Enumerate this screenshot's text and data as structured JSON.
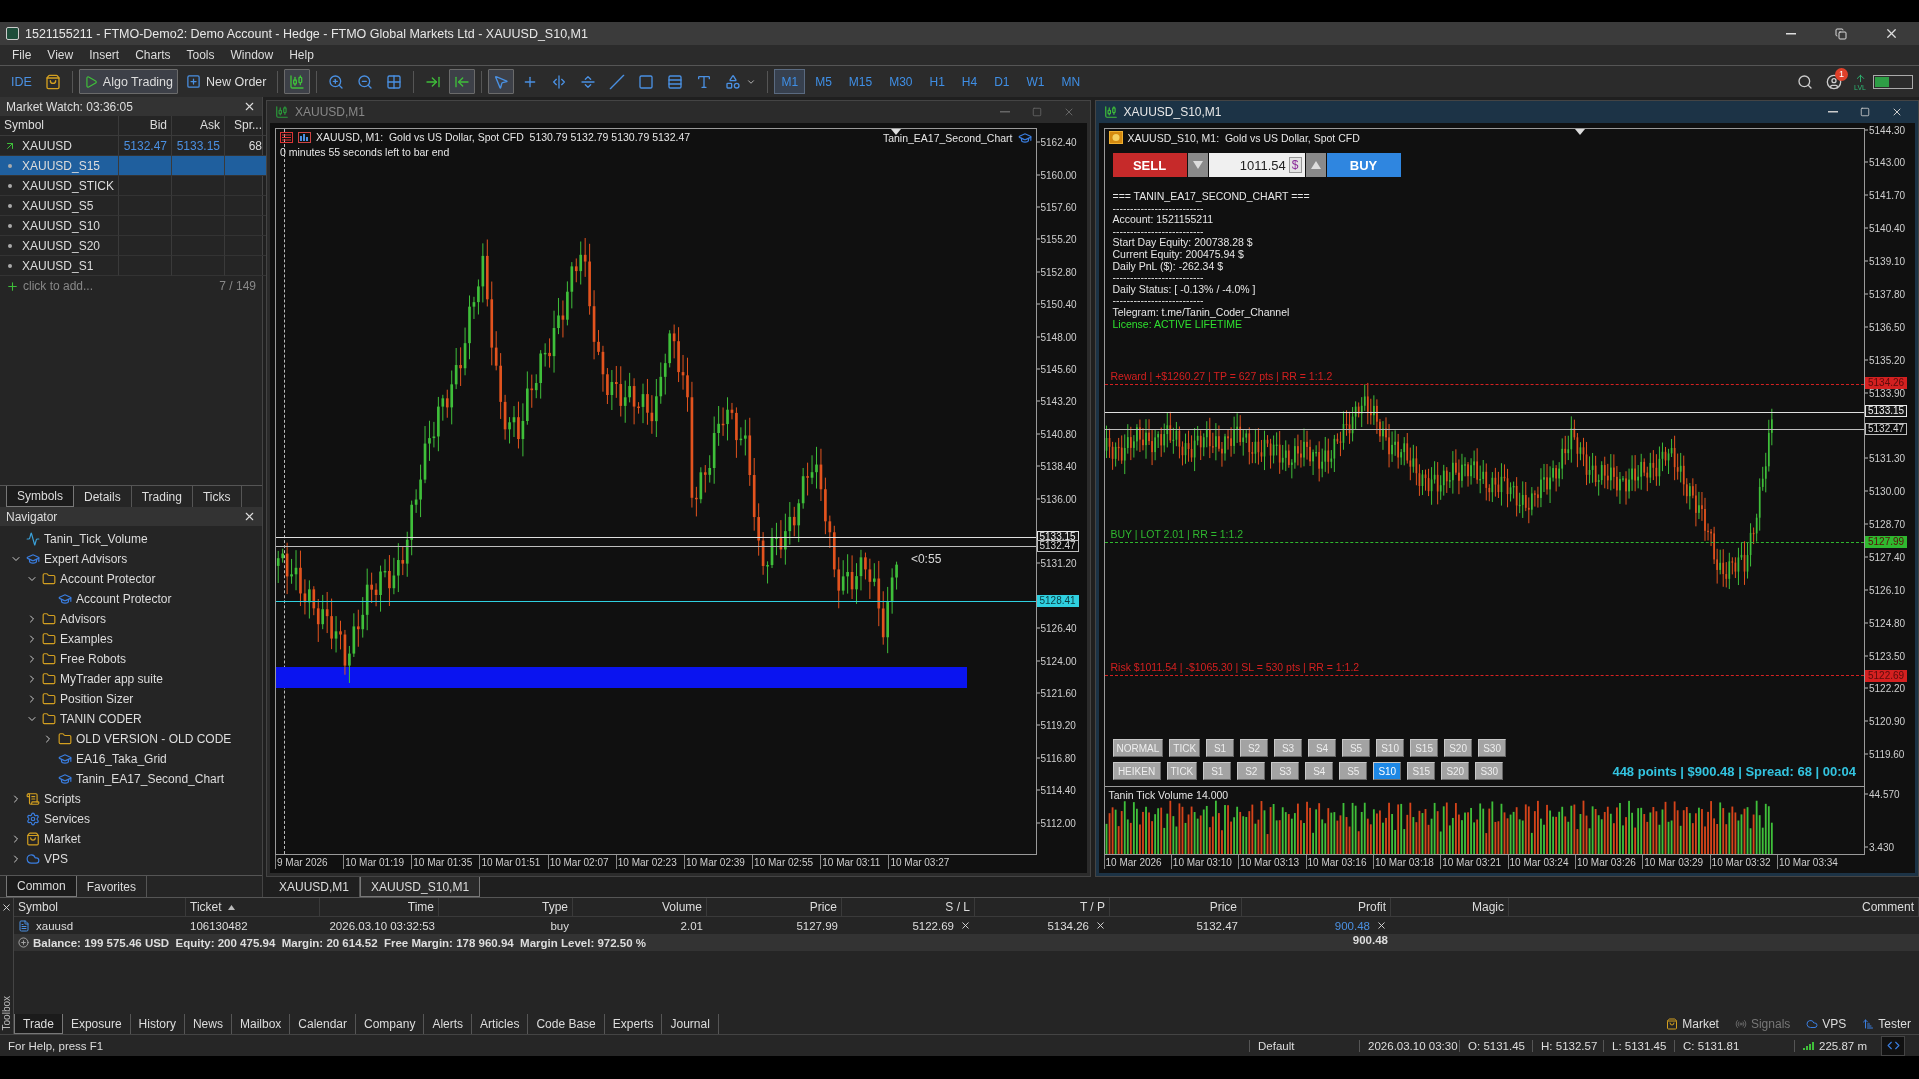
{
  "window": {
    "title": "1521155211 - FTMO-Demo2: Demo Account - Hedge - FTMO Global Markets Ltd - XAUUSD_S10,M1"
  },
  "menu": [
    "File",
    "View",
    "Insert",
    "Charts",
    "Tools",
    "Window",
    "Help"
  ],
  "toolbar": {
    "ide": "IDE",
    "algo_trading": {
      "label": "Algo Trading",
      "on": true
    },
    "new_order": "New Order",
    "tools": [
      {
        "kind": "candles",
        "selected": true
      },
      {
        "kind": "zoom-in",
        "selected": false
      },
      {
        "kind": "zoom-out",
        "selected": false
      },
      {
        "kind": "grid",
        "selected": false
      },
      {
        "kind": "autoscroll",
        "selected": false
      },
      {
        "kind": "shift",
        "selected": true
      },
      {
        "kind": "cursor",
        "selected": true
      },
      {
        "kind": "crosshair",
        "selected": false
      },
      {
        "kind": "vline",
        "selected": false
      },
      {
        "kind": "hline",
        "selected": false
      },
      {
        "kind": "trendline",
        "selected": false
      },
      {
        "kind": "rectangle",
        "selected": false
      },
      {
        "kind": "channel",
        "selected": false
      },
      {
        "kind": "text",
        "selected": false
      },
      {
        "kind": "shapes",
        "selected": false
      }
    ],
    "timeframes": [
      {
        "label": "M1",
        "selected": true
      },
      {
        "label": "M5",
        "selected": false
      },
      {
        "label": "M15",
        "selected": false
      },
      {
        "label": "M30",
        "selected": false
      },
      {
        "label": "H1",
        "selected": false
      },
      {
        "label": "H4",
        "selected": false
      },
      {
        "label": "D1",
        "selected": false
      },
      {
        "label": "W1",
        "selected": false
      },
      {
        "label": "MN",
        "selected": false
      }
    ],
    "notification_badge": "1",
    "level_label": "LVL"
  },
  "market_watch": {
    "title": "Market Watch: 03:36:05",
    "columns": [
      "Symbol",
      "Bid",
      "Ask",
      "Spr..."
    ],
    "rows": [
      {
        "kind": "quote",
        "symbol": "XAUUSD",
        "bid": "5132.47",
        "ask": "5133.15",
        "spread": "68",
        "selected": false
      },
      {
        "kind": "custom",
        "symbol": "XAUUSD_S15",
        "selected": true
      },
      {
        "kind": "custom",
        "symbol": "XAUUSD_STICK",
        "selected": false
      },
      {
        "kind": "custom",
        "symbol": "XAUUSD_S5",
        "selected": false
      },
      {
        "kind": "custom",
        "symbol": "XAUUSD_S10",
        "selected": false
      },
      {
        "kind": "custom",
        "symbol": "XAUUSD_S20",
        "selected": false
      },
      {
        "kind": "custom",
        "symbol": "XAUUSD_S1",
        "selected": false
      }
    ],
    "add_placeholder": "click to add...",
    "count": "7 / 149",
    "tabs": [
      {
        "label": "Symbols",
        "selected": true
      },
      {
        "label": "Details",
        "selected": false
      },
      {
        "label": "Trading",
        "selected": false
      },
      {
        "label": "Ticks",
        "selected": false
      }
    ]
  },
  "navigator": {
    "title": "Navigator",
    "tree": [
      {
        "kind": "indicator",
        "label": "Tanin_Tick_Volume"
      },
      {
        "kind": "group",
        "label": "Expert Advisors",
        "expanded": true,
        "children": [
          {
            "kind": "folder",
            "label": "Account Protector",
            "expanded": true,
            "children": [
              {
                "kind": "expert",
                "label": "Account Protector"
              }
            ]
          },
          {
            "kind": "folder",
            "label": "Advisors",
            "expanded": false
          },
          {
            "kind": "folder",
            "label": "Examples",
            "expanded": false
          },
          {
            "kind": "folder",
            "label": "Free Robots",
            "expanded": false
          },
          {
            "kind": "folder",
            "label": "MyTrader app suite",
            "expanded": false
          },
          {
            "kind": "folder",
            "label": "Position Sizer",
            "expanded": false
          },
          {
            "kind": "folder",
            "label": "TANIN CODER",
            "expanded": true,
            "children": [
              {
                "kind": "folder",
                "label": "OLD VERSION - OLD CODE",
                "expanded": false
              },
              {
                "kind": "expert",
                "label": "EA16_Taka_Grid"
              },
              {
                "kind": "expert",
                "label": "Tanin_EA17_Second_Chart"
              }
            ]
          }
        ]
      },
      {
        "kind": "scripts",
        "label": "Scripts",
        "expanded": false
      },
      {
        "kind": "services",
        "label": "Services"
      },
      {
        "kind": "market",
        "label": "Market",
        "expanded": false
      },
      {
        "kind": "vps",
        "label": "VPS",
        "expanded": false
      }
    ],
    "tabs": [
      {
        "label": "Common",
        "selected": true
      },
      {
        "label": "Favorites",
        "selected": false
      }
    ]
  },
  "chart_left": {
    "title": "XAUUSD,M1",
    "info": "XAUUSD, M1:  Gold vs US Dollar, Spot CFD  5130.79 5132.79 5130.79 5132.47",
    "countdown": "0 minutes 55 seconds left to bar end",
    "expert": "Tanin_EA17_Second_Chart",
    "bar_timer": "<0:55",
    "price_ticks": [
      "5162.40",
      "5160.00",
      "5157.60",
      "5155.20",
      "5152.80",
      "5150.40",
      "5148.00",
      "5145.60",
      "5143.20",
      "5140.80",
      "5138.40",
      "5136.00",
      "5131.20",
      "5126.40",
      "5124.00",
      "5121.60",
      "5119.20",
      "5116.80",
      "5114.40",
      "5112.00"
    ],
    "price_tags": [
      {
        "kind": "ask",
        "text": "5133.15"
      },
      {
        "kind": "bid",
        "text": "5132.47"
      },
      {
        "kind": "level",
        "text": "5128.41"
      }
    ],
    "time_ticks": [
      "9 Mar 2026",
      "10 Mar 01:19",
      "10 Mar 01:35",
      "10 Mar 01:51",
      "10 Mar 02:07",
      "10 Mar 02:23",
      "10 Mar 02:39",
      "10 Mar 02:55",
      "10 Mar 03:11",
      "10 Mar 03:27"
    ]
  },
  "chart_right": {
    "title": "XAUUSD_S10,M1",
    "info": "XAUUSD_S10, M1:  Gold vs US Dollar, Spot CFD",
    "trade_panel": {
      "sell": "SELL",
      "lot": "1011.54",
      "currency": "$",
      "buy": "BUY"
    },
    "dashboard": [
      {
        "kind": "heading",
        "text": "=== TANIN_EA17_SECOND_CHART ==="
      },
      {
        "kind": "rule",
        "text": "--------------------------"
      },
      {
        "kind": "line",
        "text": "Account: 1521155211"
      },
      {
        "kind": "rule",
        "text": "--------------------------"
      },
      {
        "kind": "line",
        "text": "Start Day Equity: 200738.28 $"
      },
      {
        "kind": "line",
        "text": "Current Equity: 200475.94 $"
      },
      {
        "kind": "line",
        "text": "Daily PnL ($): -262.34 $"
      },
      {
        "kind": "rule",
        "text": "--------------------------"
      },
      {
        "kind": "line",
        "text": "Daily Status: [ -0.13% / -4.0% ]"
      },
      {
        "kind": "rule",
        "text": "--------------------------"
      },
      {
        "kind": "line",
        "text": "Telegram: t.me/Tanin_Coder_Channel"
      },
      {
        "kind": "license",
        "text": "License: ACTIVE LIFETIME"
      }
    ],
    "trade_lines": [
      {
        "label": "Reward | +$1260.27 | TP = 627 pts | RR = 1:1.2",
        "tag": "5134.26",
        "color": "#d42020"
      },
      {
        "label": "BUY | LOT 2.01 | RR = 1:1.2",
        "tag": "5127.99",
        "color": "#2fb82f"
      },
      {
        "label": "Risk $1011.54 | -$1065.30 | SL = 530 pts | RR = 1:1.2",
        "tag": "5122.69",
        "color": "#d42020"
      }
    ],
    "price_tags": [
      {
        "kind": "ask",
        "text": "5133.15"
      },
      {
        "kind": "bid",
        "text": "5132.47"
      }
    ],
    "price_ticks": [
      "5144.30",
      "5143.00",
      "5141.70",
      "5140.40",
      "5139.10",
      "5137.80",
      "5136.50",
      "5135.20",
      "5133.90",
      "5131.30",
      "5130.00",
      "5128.70",
      "5127.40",
      "5126.10",
      "5124.80",
      "5123.50",
      "5122.20",
      "5120.90",
      "5119.60"
    ],
    "mode_rows": [
      {
        "label": "NORMAL",
        "buttons": [
          {
            "label": "TICK",
            "selected": false
          },
          {
            "label": "S1",
            "selected": false
          },
          {
            "label": "S2",
            "selected": false
          },
          {
            "label": "S3",
            "selected": false
          },
          {
            "label": "S4",
            "selected": false
          },
          {
            "label": "S5",
            "selected": false
          },
          {
            "label": "S10",
            "selected": false
          },
          {
            "label": "S15",
            "selected": false
          },
          {
            "label": "S20",
            "selected": false
          },
          {
            "label": "S30",
            "selected": false
          }
        ]
      },
      {
        "label": "HEIKEN",
        "buttons": [
          {
            "label": "TICK",
            "selected": false
          },
          {
            "label": "S1",
            "selected": false
          },
          {
            "label": "S2",
            "selected": false
          },
          {
            "label": "S3",
            "selected": false
          },
          {
            "label": "S4",
            "selected": false
          },
          {
            "label": "S5",
            "selected": false
          },
          {
            "label": "S10",
            "selected": true
          },
          {
            "label": "S15",
            "selected": false
          },
          {
            "label": "S20",
            "selected": false
          },
          {
            "label": "S30",
            "selected": false
          }
        ]
      }
    ],
    "status": "448 points | $900.48 | Spread: 68 | 00:04",
    "volume": {
      "title": "Tanin Tick Volume 14.000",
      "max": "44.570",
      "min": "3.430"
    },
    "time_ticks": [
      "10 Mar 2026",
      "10 Mar 03:10",
      "10 Mar 03:13",
      "10 Mar 03:16",
      "10 Mar 03:18",
      "10 Mar 03:21",
      "10 Mar 03:24",
      "10 Mar 03:26",
      "10 Mar 03:29",
      "10 Mar 03:32",
      "10 Mar 03:34"
    ]
  },
  "chart_tabs": [
    {
      "label": "XAUUSD,M1",
      "selected": false
    },
    {
      "label": "XAUUSD_S10,M1",
      "selected": true
    }
  ],
  "toolbox": {
    "label": "Toolbox",
    "columns": [
      "Symbol",
      "Ticket",
      "Time",
      "Type",
      "Volume",
      "Price",
      "S / L",
      "T / P",
      "Price",
      "Profit",
      "Magic",
      "Comment"
    ],
    "positions": [
      {
        "symbol": "xauusd",
        "ticket": "106130482",
        "time": "2026.03.10 03:32:53",
        "type": "buy",
        "volume": "2.01",
        "price": "5127.99",
        "sl": "5122.69",
        "tp": "5134.26",
        "current": "5132.47",
        "profit": "900.48"
      }
    ],
    "summary": "Balance: 199 575.46 USD  Equity: 200 475.94  Margin: 20 614.52  Free Margin: 178 960.94  Margin Level: 972.50 %",
    "total_profit": "900.48",
    "tabs": [
      {
        "label": "Trade",
        "selected": true
      },
      {
        "label": "Exposure",
        "selected": false
      },
      {
        "label": "History",
        "selected": false
      },
      {
        "label": "News",
        "selected": false
      },
      {
        "label": "Mailbox",
        "selected": false
      },
      {
        "label": "Calendar",
        "selected": false
      },
      {
        "label": "Company",
        "selected": false
      },
      {
        "label": "Alerts",
        "selected": false
      },
      {
        "label": "Articles",
        "selected": false
      },
      {
        "label": "Code Base",
        "selected": false
      },
      {
        "label": "Experts",
        "selected": false
      },
      {
        "label": "Journal",
        "selected": false
      }
    ],
    "links": [
      {
        "kind": "market",
        "label": "Market",
        "disabled": false
      },
      {
        "kind": "signals",
        "label": "Signals",
        "disabled": true
      },
      {
        "kind": "vps",
        "label": "VPS",
        "disabled": false
      },
      {
        "kind": "tester",
        "label": "Tester",
        "disabled": false
      }
    ]
  },
  "status_bar": {
    "help": "For Help, press F1",
    "profile": "Default",
    "datetime": "2026.03.10 03:30",
    "open": "O: 5131.45",
    "high": "H: 5132.57",
    "low": "L: 5131.45",
    "close": "C: 5131.81",
    "ping": "225.87 m"
  }
}
